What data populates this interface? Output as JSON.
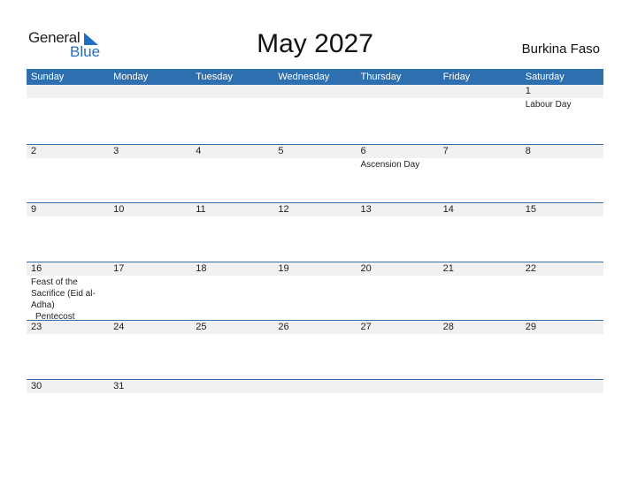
{
  "logo": {
    "general": "General",
    "blue": "Blue"
  },
  "title": "May 2027",
  "country": "Burkina Faso",
  "colors": {
    "accent": "#2e6fb0",
    "date_strip": "#f1f1f1"
  },
  "weekdays": [
    "Sunday",
    "Monday",
    "Tuesday",
    "Wednesday",
    "Thursday",
    "Friday",
    "Saturday"
  ],
  "weeks": [
    [
      {
        "day": "",
        "events": []
      },
      {
        "day": "",
        "events": []
      },
      {
        "day": "",
        "events": []
      },
      {
        "day": "",
        "events": []
      },
      {
        "day": "",
        "events": []
      },
      {
        "day": "",
        "events": []
      },
      {
        "day": "1",
        "events": [
          "Labour Day"
        ]
      }
    ],
    [
      {
        "day": "2",
        "events": []
      },
      {
        "day": "3",
        "events": []
      },
      {
        "day": "4",
        "events": []
      },
      {
        "day": "5",
        "events": []
      },
      {
        "day": "6",
        "events": [
          "Ascension Day"
        ]
      },
      {
        "day": "7",
        "events": []
      },
      {
        "day": "8",
        "events": []
      }
    ],
    [
      {
        "day": "9",
        "events": []
      },
      {
        "day": "10",
        "events": []
      },
      {
        "day": "11",
        "events": []
      },
      {
        "day": "12",
        "events": []
      },
      {
        "day": "13",
        "events": []
      },
      {
        "day": "14",
        "events": []
      },
      {
        "day": "15",
        "events": []
      }
    ],
    [
      {
        "day": "16",
        "events": [
          "Feast of the Sacrifice (Eid al-Adha)",
          "Pentecost"
        ]
      },
      {
        "day": "17",
        "events": []
      },
      {
        "day": "18",
        "events": []
      },
      {
        "day": "19",
        "events": []
      },
      {
        "day": "20",
        "events": []
      },
      {
        "day": "21",
        "events": []
      },
      {
        "day": "22",
        "events": []
      }
    ],
    [
      {
        "day": "23",
        "events": []
      },
      {
        "day": "24",
        "events": []
      },
      {
        "day": "25",
        "events": []
      },
      {
        "day": "26",
        "events": []
      },
      {
        "day": "27",
        "events": []
      },
      {
        "day": "28",
        "events": []
      },
      {
        "day": "29",
        "events": []
      }
    ],
    [
      {
        "day": "30",
        "events": []
      },
      {
        "day": "31",
        "events": []
      },
      {
        "day": "",
        "events": []
      },
      {
        "day": "",
        "events": []
      },
      {
        "day": "",
        "events": []
      },
      {
        "day": "",
        "events": []
      },
      {
        "day": "",
        "events": []
      }
    ]
  ]
}
